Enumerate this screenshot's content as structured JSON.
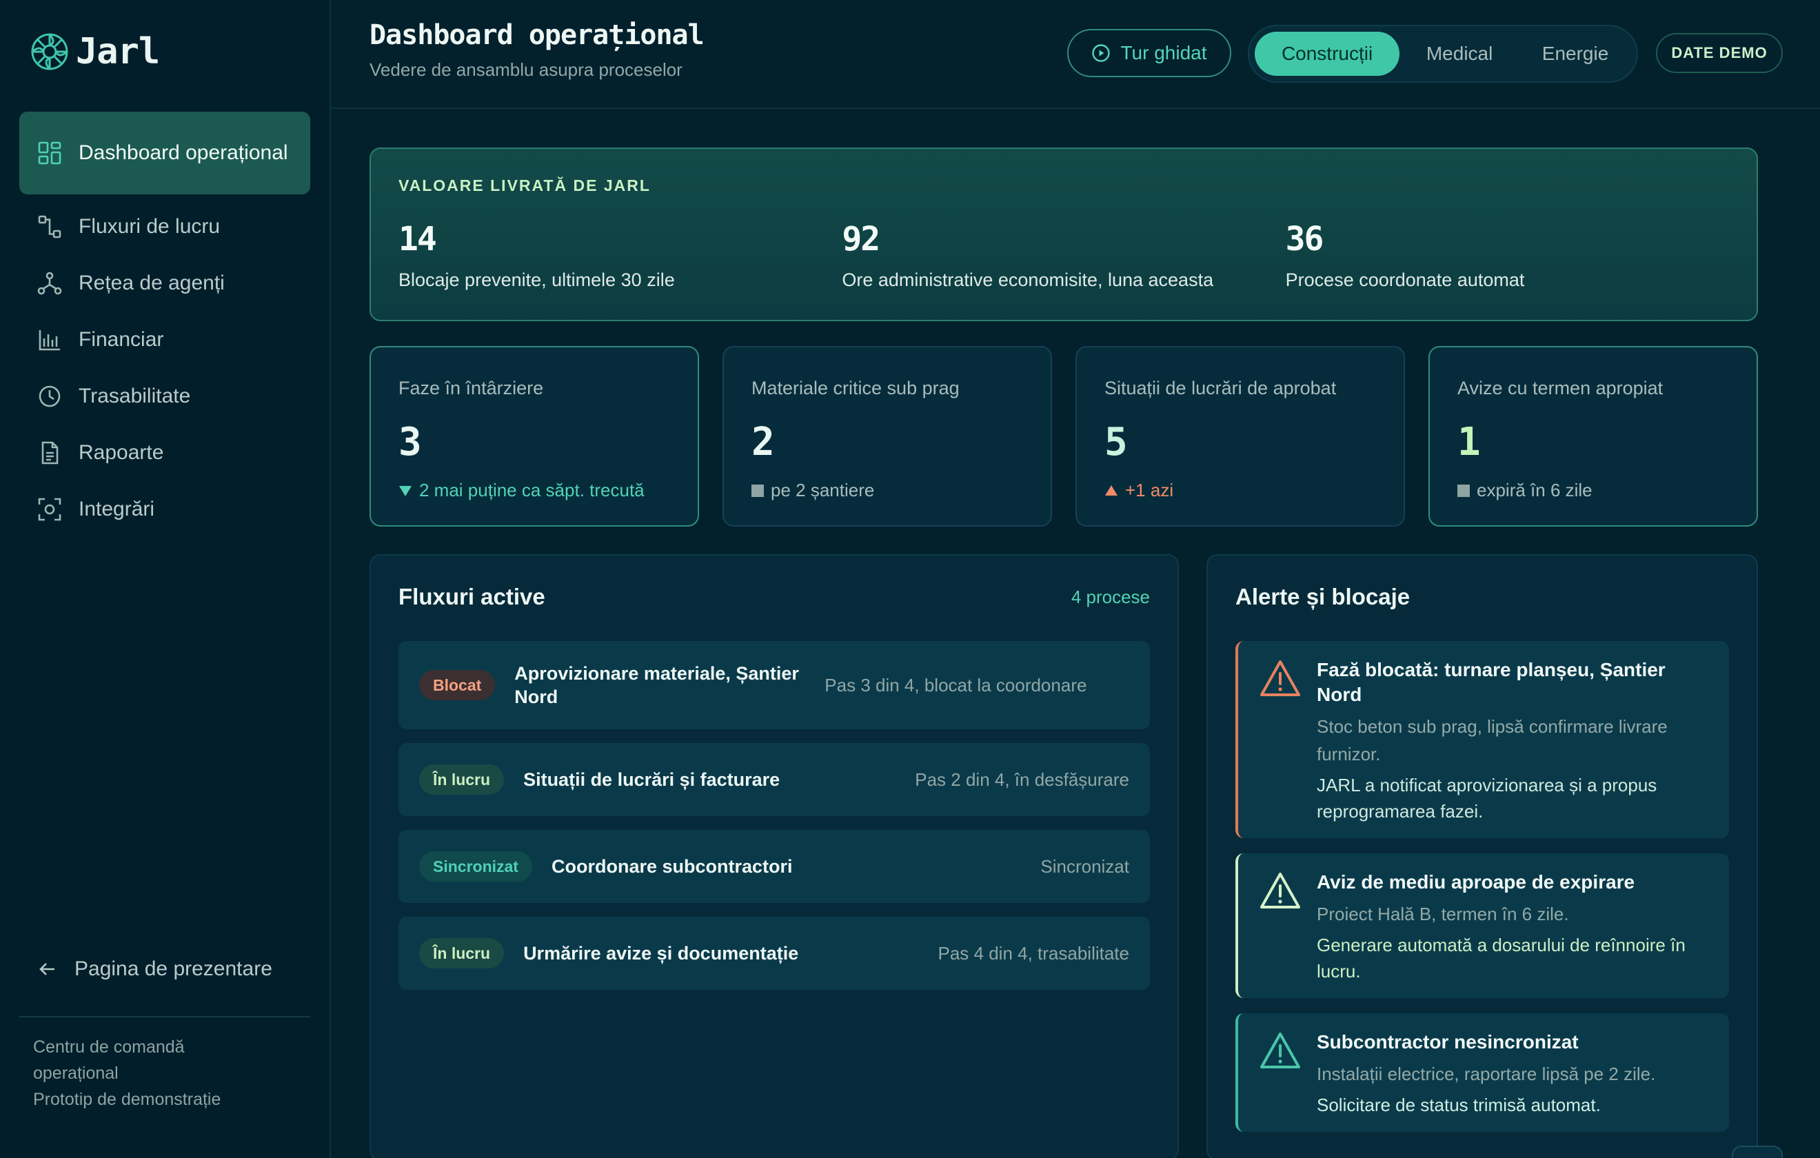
{
  "app": {
    "logo_text": "Jarl"
  },
  "sidebar": {
    "items": [
      {
        "label": "Dashboard operațional",
        "icon": "dashboard-grid-icon"
      },
      {
        "label": "Fluxuri de lucru",
        "icon": "workflow-icon"
      },
      {
        "label": "Rețea de agenți",
        "icon": "network-icon"
      },
      {
        "label": "Financiar",
        "icon": "bar-chart-icon"
      },
      {
        "label": "Trasabilitate",
        "icon": "clock-icon"
      },
      {
        "label": "Rapoarte",
        "icon": "document-icon"
      },
      {
        "label": "Integrări",
        "icon": "integration-icon"
      }
    ],
    "back_link": "Pagina de prezentare",
    "footer_line1": "Centru de comandă operațional",
    "footer_line2": "Prototip de demonstrație"
  },
  "header": {
    "title": "Dashboard operațional",
    "subtitle": "Vedere de ansamblu asupra proceselor",
    "tour_button": "Tur ghidat",
    "segments": [
      "Construcții",
      "Medical",
      "Energie"
    ],
    "selected_segment": "Construcții",
    "demo_badge": "DATE DEMO"
  },
  "value_banner": {
    "title": "VALOARE LIVRATĂ DE JARL",
    "stats": [
      {
        "value": "14",
        "label": "Blocaje prevenite, ultimele 30 zile"
      },
      {
        "value": "92",
        "label": "Ore administrative economisite, luna aceasta"
      },
      {
        "value": "36",
        "label": "Procese coordonate automat"
      }
    ]
  },
  "kpis": [
    {
      "label": "Faze în întârziere",
      "value": "3",
      "note": "2 mai puține ca săpt. trecută",
      "trend": "down"
    },
    {
      "label": "Materiale critice sub prag",
      "value": "2",
      "note": "pe 2 șantiere",
      "trend": "neutral"
    },
    {
      "label": "Situații de lucrări de aprobat",
      "value": "5",
      "note": "+1 azi",
      "trend": "up"
    },
    {
      "label": "Avize cu termen apropiat",
      "value": "1",
      "note": "expiră în 6 zile",
      "trend": "neutral"
    }
  ],
  "flows": {
    "title": "Fluxuri active",
    "count": "4 procese",
    "items": [
      {
        "status": "Blocat",
        "name": "Aprovizionare materiale, Șantier Nord",
        "detail": "Pas 3 din 4, blocat la coordonare"
      },
      {
        "status": "În lucru",
        "name": "Situații de lucrări și facturare",
        "detail": "Pas 2 din 4, în desfășurare"
      },
      {
        "status": "Sincronizat",
        "name": "Coordonare subcontractori",
        "detail": "Sincronizat"
      },
      {
        "status": "În lucru",
        "name": "Urmărire avize și documentație",
        "detail": "Pas 4 din 4, trasabilitate"
      }
    ]
  },
  "alerts": {
    "title": "Alerte și blocaje",
    "items": [
      {
        "title": "Fază blocată: turnare planșeu, Șantier Nord",
        "description": "Stoc beton sub prag, lipsă confirmare livrare furnizor.",
        "action": "JARL a notificat aprovizionarea și a propus reprogramarea fazei.",
        "severity": "danger"
      },
      {
        "title": "Aviz de mediu aproape de expirare",
        "description": "Proiect Hală B, termen în 6 zile.",
        "action": "Generare automată a dosarului de reînnoire în lucru.",
        "severity": "warning"
      },
      {
        "title": "Subcontractor nesincronizat",
        "description": "Instalații electrice, raportare lipsă pe 2 zile.",
        "action": "Solicitare de status trimisă automat.",
        "severity": "info"
      }
    ]
  },
  "colors": {
    "background": "#03202d",
    "accent": "#3fc7a8",
    "danger": "#e07a5b",
    "warning": "#cdeec2",
    "info": "#3fb9a0"
  }
}
